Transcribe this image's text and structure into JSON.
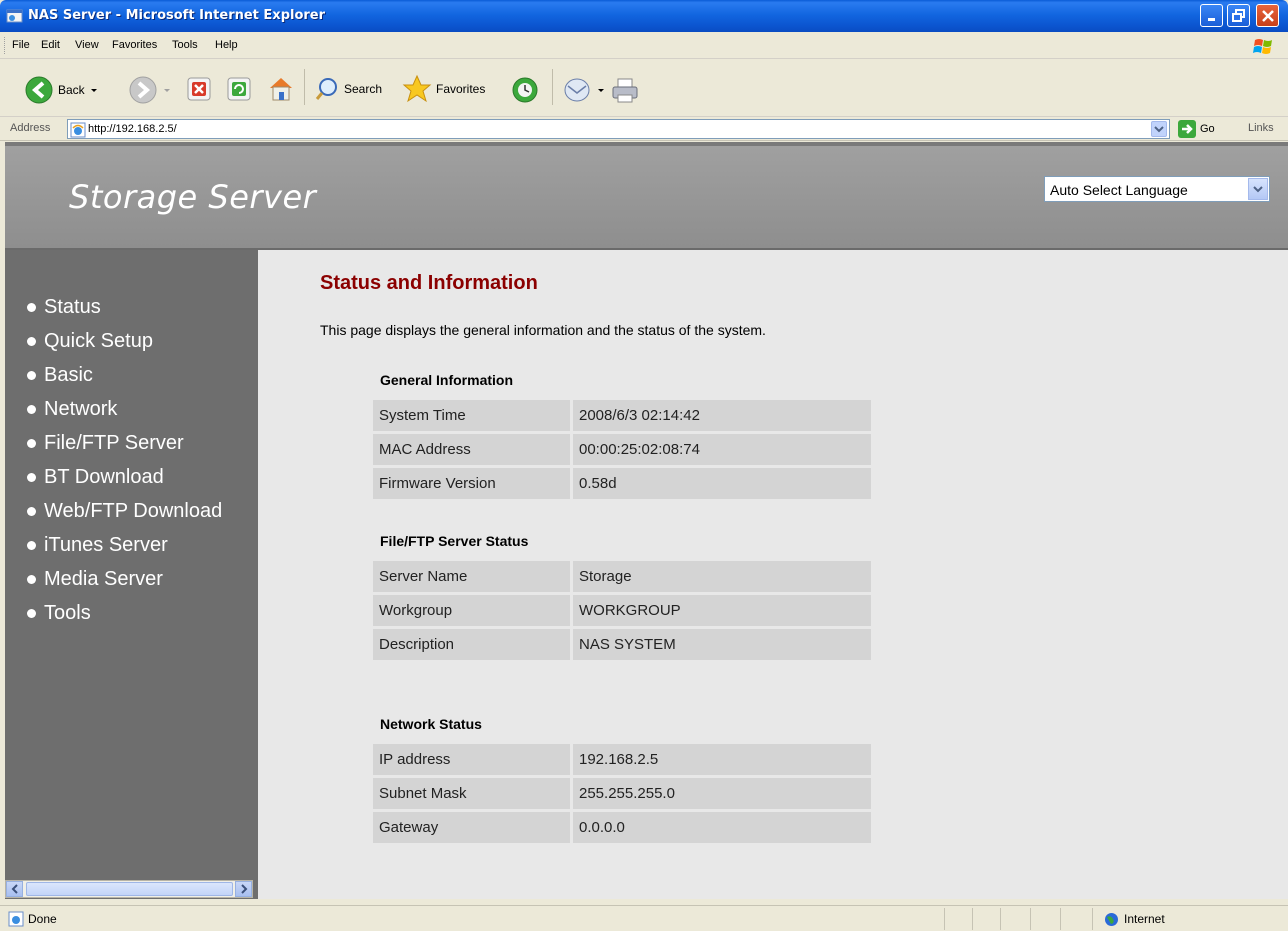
{
  "window": {
    "title": "NAS Server - Microsoft Internet Explorer"
  },
  "menu": {
    "items": [
      "File",
      "Edit",
      "View",
      "Favorites",
      "Tools",
      "Help"
    ]
  },
  "toolbar": {
    "back_label": "Back",
    "search_label": "Search",
    "favorites_label": "Favorites"
  },
  "address": {
    "label": "Address",
    "url": "http://192.168.2.5/",
    "go_label": "Go",
    "links_label": "Links"
  },
  "header": {
    "brand": "Storage Server",
    "language": "Auto Select Language"
  },
  "sidebar": {
    "items": [
      {
        "label": "Status"
      },
      {
        "label": "Quick Setup"
      },
      {
        "label": "Basic"
      },
      {
        "label": "Network"
      },
      {
        "label": "File/FTP Server"
      },
      {
        "label": "BT Download"
      },
      {
        "label": "Web/FTP Download"
      },
      {
        "label": "iTunes Server"
      },
      {
        "label": "Media Server"
      },
      {
        "label": "Tools"
      }
    ]
  },
  "main": {
    "title": "Status and Information",
    "description": "This page displays the general information and the status of the system.",
    "general": {
      "title": "General Information",
      "rows": [
        {
          "key": "System Time",
          "value": "2008/6/3 02:14:42"
        },
        {
          "key": "MAC Address",
          "value": "00:00:25:02:08:74"
        },
        {
          "key": "Firmware Version",
          "value": "0.58d"
        }
      ]
    },
    "ftp": {
      "title": "File/FTP Server Status",
      "rows": [
        {
          "key": "Server Name",
          "value": "Storage"
        },
        {
          "key": "Workgroup",
          "value": "WORKGROUP"
        },
        {
          "key": "Description",
          "value": "NAS SYSTEM"
        }
      ]
    },
    "network": {
      "title": "Network Status",
      "rows": [
        {
          "key": "IP address",
          "value": "192.168.2.5"
        },
        {
          "key": "Subnet Mask",
          "value": "255.255.255.0"
        },
        {
          "key": "Gateway",
          "value": "0.0.0.0"
        }
      ]
    }
  },
  "status": {
    "text": "Done",
    "zone": "Internet"
  },
  "colors": {
    "title_red": "#8b0000",
    "sidebar_bg": "#6e6e6e",
    "row_bg": "#d4d4d4"
  }
}
